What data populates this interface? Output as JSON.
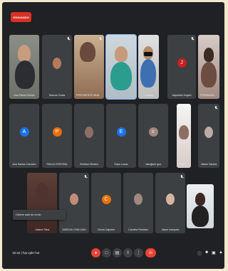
{
  "recording_label": "GRAVANDO",
  "participants": [
    {
      "name": "Ana Paula Gomes",
      "initial": "",
      "color": ""
    },
    {
      "name": "Marcos Costa",
      "initial": "",
      "color": ""
    },
    {
      "name": "PRESIDENTE MUNICIPAL",
      "initial": "",
      "color": ""
    },
    {
      "name": "",
      "initial": "",
      "color": ""
    },
    {
      "name": "Cristina",
      "initial": "",
      "color": ""
    },
    {
      "name": "Jaqueline Angelo",
      "initial": "J",
      "color": "#c5221f"
    },
    {
      "name": "FERNANDA ALVES SILVA",
      "initial": "",
      "color": ""
    },
    {
      "name": "Ana Santos Carneiro",
      "initial": "A",
      "color": "#1a73e8"
    },
    {
      "name": "PAULA CRISTINA",
      "initial": "P",
      "color": "#e8710a"
    },
    {
      "name": "Bethina Oliveira",
      "initial": "",
      "color": ""
    },
    {
      "name": "Edya Lucas",
      "initial": "E",
      "color": "#1a73e8"
    },
    {
      "name": "claudjane gsa",
      "initial": "c",
      "color": "#a1887f"
    },
    {
      "name": "Rosa Pires",
      "initial": "",
      "color": ""
    },
    {
      "name": "Liliane Santos",
      "initial": "",
      "color": ""
    },
    {
      "name": "Juliana Silva",
      "initial": "",
      "color": ""
    },
    {
      "name": "MÁRCIA LYNA LIMA",
      "initial": "",
      "color": ""
    },
    {
      "name": "Clécia Cajueiro",
      "initial": "C",
      "color": "#e8710a"
    },
    {
      "name": "Caroline Romano",
      "initial": "",
      "color": ""
    },
    {
      "name": "Jayne marques",
      "initial": "",
      "color": ""
    },
    {
      "name": "",
      "initial": "",
      "color": ""
    }
  ],
  "popup_text": "Liberar sala do modo",
  "footer": {
    "time": "16:32",
    "meeting_code": "fvp-vjde-hot"
  },
  "controls": [
    "mic-off",
    "camera",
    "captions",
    "present",
    "more",
    "end-call"
  ],
  "right_icons": [
    "info",
    "people",
    "chat",
    "activities"
  ]
}
